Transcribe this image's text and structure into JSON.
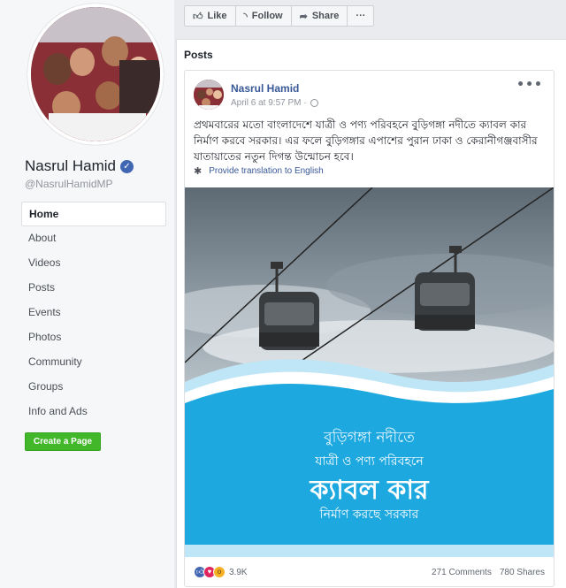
{
  "profile": {
    "name": "Nasrul Hamid",
    "handle": "@NasrulHamidMP",
    "verified_icon": "verified-badge-icon"
  },
  "sidebar": {
    "items": [
      {
        "label": "Home"
      },
      {
        "label": "About"
      },
      {
        "label": "Videos"
      },
      {
        "label": "Posts"
      },
      {
        "label": "Events"
      },
      {
        "label": "Photos"
      },
      {
        "label": "Community"
      },
      {
        "label": "Groups"
      },
      {
        "label": "Info and Ads"
      }
    ],
    "create_page_label": "Create a Page"
  },
  "actions": {
    "like": "Like",
    "follow": "Follow",
    "share": "Share",
    "more": "···"
  },
  "posts": {
    "heading": "Posts",
    "post": {
      "author": "Nasrul Hamid",
      "timestamp": "April 6 at 9:57 PM ·",
      "text": "প্রথমবারের মতো বাংলাদেশে যাত্রী ও পণ্য পরিবহনে বুড়িগঙ্গা নদীতে ক্যাবল কার নির্মাণ করবে সরকার। এর ফলে বুড়িগঙ্গার এপাশের পুরান ঢাকা ও কেরানীগঞ্জবাসীর যাতায়াতের নতুন দিগন্ত উন্মোচন হবে।",
      "translate_label": "Provide translation to English",
      "image_text": {
        "line1": "বুড়িগঙ্গা নদীতে",
        "line2": "যাত্রী ও পণ্য পরিবহনে",
        "line3": "ক্যাবল কার",
        "line4": "নির্মাণ করছে সরকার"
      },
      "reactions_count": "3.9K",
      "comments": "271 Comments",
      "shares": "780 Shares"
    }
  },
  "colors": {
    "link": "#385898",
    "green_button": "#42b72a",
    "banner_blue": "#1ea8e0"
  }
}
